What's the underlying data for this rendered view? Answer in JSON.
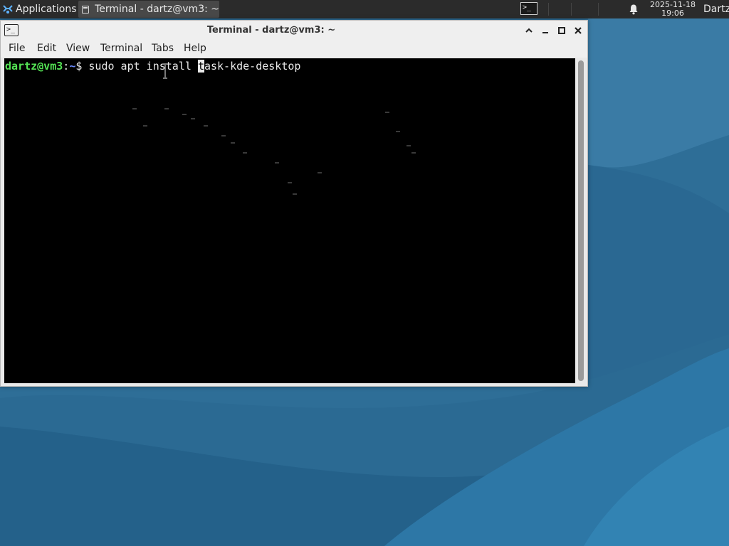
{
  "panel": {
    "applications_label": "Applications",
    "applications_suffix": "≡",
    "task_label": "Terminal - dartz@vm3: ~",
    "launcher_glyph": ">_",
    "clock_date": "2025-11-18",
    "clock_time": "19:06",
    "user": "Dartz",
    "icons": {
      "menu": "xfce-mouse-icon",
      "task": "terminal-icon",
      "notifications": "bell-icon"
    }
  },
  "window": {
    "title": "Terminal - dartz@vm3: ~",
    "icon_glyph": ">_",
    "controls": [
      "chevron-up-icon",
      "minimize-icon",
      "maximize-icon",
      "close-icon"
    ]
  },
  "menu": {
    "file": "File",
    "edit": "Edit",
    "view": "View",
    "terminal": "Terminal",
    "tabs": "Tabs",
    "help": "Help"
  },
  "terminal": {
    "prompt_user": "dartz@vm3",
    "prompt_sep": ":",
    "prompt_path": "~",
    "prompt_symbol": "$ ",
    "command_before_cursor": "sudo apt install ",
    "cursor_char": "t",
    "command_after_cursor": "ask-kde-desktop"
  },
  "colors": {
    "prompt_user": "#54e354",
    "prompt_path": "#6c8cff",
    "terminal_bg": "#000000",
    "desktop_bg": "#2f6f98"
  }
}
